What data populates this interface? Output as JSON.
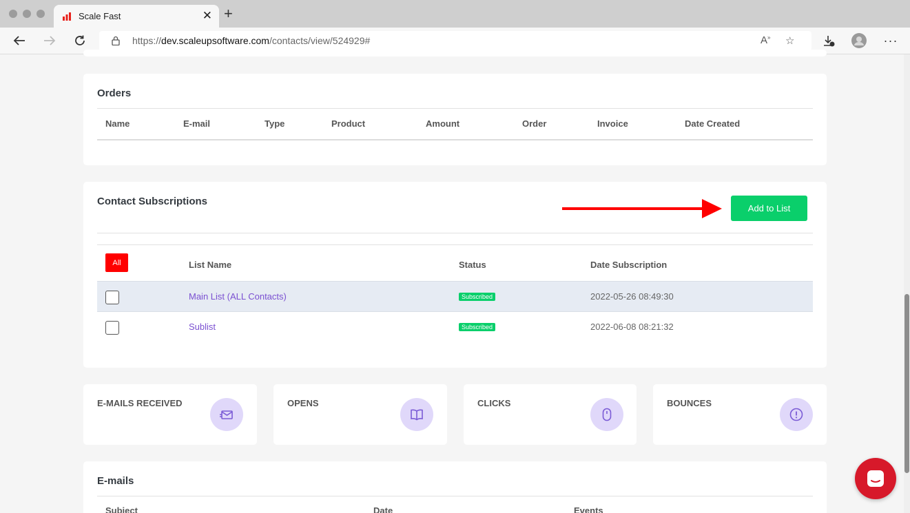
{
  "browser": {
    "tab_title": "Scale Fast",
    "url_prefix": "https://",
    "url_domain": "dev.scaleupsoftware.com",
    "url_path": "/contacts/view/524929#",
    "accent_color": "#e8211b"
  },
  "orders": {
    "title": "Orders",
    "columns": [
      "Name",
      "E-mail",
      "Type",
      "Product",
      "Amount",
      "Order",
      "Invoice",
      "Date Created"
    ]
  },
  "subscriptions": {
    "title": "Contact Subscriptions",
    "add_button": "Add to List",
    "all_button": "All",
    "columns": [
      "List Name",
      "Status",
      "Date Subscription"
    ],
    "rows": [
      {
        "list_name": "Main List (ALL Contacts)",
        "status": "Subscribed",
        "date": "2022-05-26 08:49:30"
      },
      {
        "list_name": "Sublist",
        "status": "Subscribed",
        "date": "2022-06-08 08:21:32"
      }
    ],
    "status_color": "#0acf6b"
  },
  "stats": [
    {
      "label": "E-MAILS RECEIVED",
      "icon": "envelope-icon"
    },
    {
      "label": "OPENS",
      "icon": "book-icon"
    },
    {
      "label": "CLICKS",
      "icon": "mouse-icon"
    },
    {
      "label": "BOUNCES",
      "icon": "alert-circle-icon"
    }
  ],
  "emails": {
    "title": "E-mails",
    "columns": [
      "Subject",
      "Date",
      "Events"
    ]
  }
}
